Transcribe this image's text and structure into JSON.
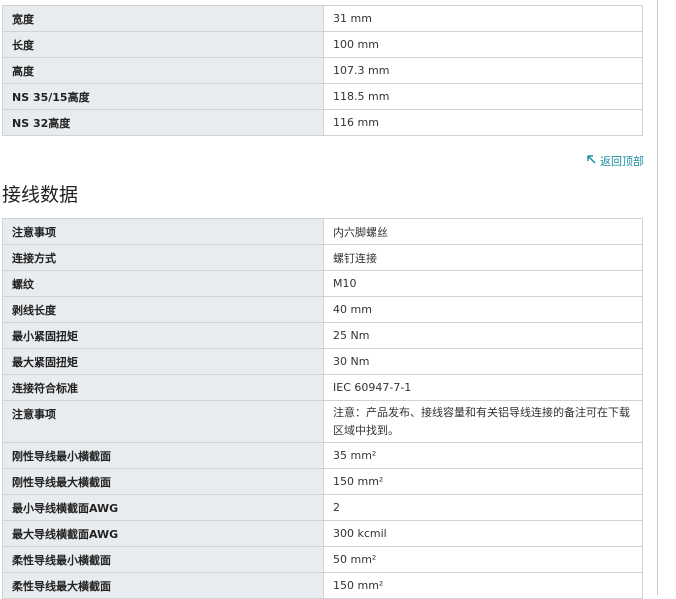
{
  "dimensions": [
    {
      "label": "宽度",
      "value": "31 mm"
    },
    {
      "label": "长度",
      "value": "100 mm"
    },
    {
      "label": "高度",
      "value": "107.3 mm"
    },
    {
      "label": "NS 35/15高度",
      "value": "118.5 mm"
    },
    {
      "label": "NS 32高度",
      "value": "116 mm"
    }
  ],
  "back_to_top": {
    "label": "返回顶部",
    "icon": "arrow-up-left-icon"
  },
  "section_title": "接线数据",
  "connection": [
    {
      "label": "注意事项",
      "value": "内六脚螺丝"
    },
    {
      "label": "连接方式",
      "value": "螺钉连接"
    },
    {
      "label": "螺纹",
      "value": "M10"
    },
    {
      "label": "剥线长度",
      "value": "40 mm"
    },
    {
      "label": "最小紧固扭矩",
      "value": "25 Nm"
    },
    {
      "label": "最大紧固扭矩",
      "value": "30 Nm"
    },
    {
      "label": "连接符合标准",
      "value": "IEC 60947-7-1"
    },
    {
      "label": "注意事项",
      "value": "注意：产品发布、接线容量和有关铝导线连接的备注可在下载区域中找到。"
    },
    {
      "label": "刚性导线最小横截面",
      "value": "35 mm²"
    },
    {
      "label": "刚性导线最大横截面",
      "value": "150 mm²"
    },
    {
      "label": "最小导线横截面AWG",
      "value": "2"
    },
    {
      "label": "最大导线横截面AWG",
      "value": "300 kcmil"
    },
    {
      "label": "柔性导线最小横截面",
      "value": "50 mm²"
    },
    {
      "label": "柔性导线最大横截面",
      "value": "150 mm²"
    }
  ],
  "colors": {
    "link": "#1a8fa0",
    "label_bg": "#e9ecef",
    "border": "#d0d3d6"
  }
}
